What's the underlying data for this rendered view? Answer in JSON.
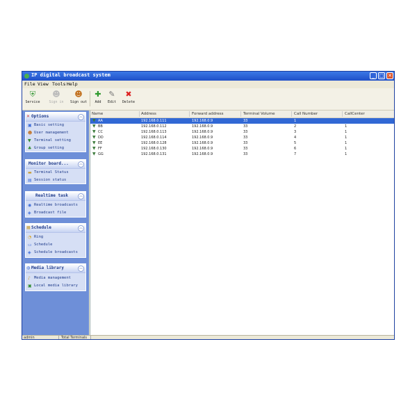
{
  "window": {
    "title": "IP digital broadcast system",
    "colors": {
      "titlebar": "#1f4fc8",
      "sidebar": "#6e8fd8",
      "selection": "#3168d5"
    }
  },
  "menu": [
    "File",
    "View",
    "Tools",
    "Help"
  ],
  "toolbar": {
    "items": [
      {
        "label": "Service",
        "icon": "shield-icon",
        "enabled": true
      },
      {
        "label": "Sign in",
        "icon": "user-icon",
        "enabled": false
      },
      {
        "label": "Sign out",
        "icon": "user-out-icon",
        "enabled": true
      },
      {
        "label": "Add",
        "icon": "add-icon",
        "enabled": true
      },
      {
        "label": "Edit",
        "icon": "edit-icon",
        "enabled": true
      },
      {
        "label": "Delete",
        "icon": "delete-icon",
        "enabled": true
      }
    ]
  },
  "sidebar": {
    "panels": [
      {
        "title": "Options",
        "icon": "options-icon",
        "items": [
          {
            "label": "Basic setting",
            "icon": "settings-icon"
          },
          {
            "label": "User management",
            "icon": "users-icon"
          },
          {
            "label": "Terminal setting",
            "icon": "terminal-icon"
          },
          {
            "label": "Group setting",
            "icon": "group-icon"
          }
        ]
      },
      {
        "title": "Monitor board...",
        "icon": "",
        "items": [
          {
            "label": "Terminal Status",
            "icon": "status-icon"
          },
          {
            "label": "Session status",
            "icon": "session-icon"
          }
        ]
      },
      {
        "title": "Realtime task",
        "icon": "",
        "items": [
          {
            "label": "Realtime broadcasts",
            "icon": "broadcast-icon"
          },
          {
            "label": "Broadcast file",
            "icon": "file-icon"
          }
        ]
      },
      {
        "title": "Schedule",
        "icon": "schedule-icon",
        "items": [
          {
            "label": "Ring",
            "icon": "ring-icon"
          },
          {
            "label": "Schedule",
            "icon": "calendar-icon"
          },
          {
            "label": "Schedule broadcasts",
            "icon": "schedule-broadcast-icon"
          }
        ]
      },
      {
        "title": "Media library",
        "icon": "media-icon",
        "items": [
          {
            "label": "Media management",
            "icon": "media-manage-icon"
          },
          {
            "label": "Local media library",
            "icon": "library-icon"
          }
        ]
      }
    ]
  },
  "table": {
    "columns": [
      "Name",
      "Address",
      "Forward address",
      "Terminal Volume",
      "Call Number",
      "CallCenter"
    ],
    "rows": [
      [
        "AA",
        "192.168.0.111",
        "192.168.0.9",
        "33",
        "1",
        ""
      ],
      [
        "BB",
        "192.168.0.112",
        "192.168.0.9",
        "33",
        "2",
        "1"
      ],
      [
        "CC",
        "192.168.0.113",
        "192.168.0.9",
        "33",
        "3",
        "1"
      ],
      [
        "DD",
        "192.168.0.114",
        "192.168.0.9",
        "33",
        "4",
        "1"
      ],
      [
        "EE",
        "192.168.0.128",
        "192.168.0.9",
        "33",
        "5",
        "1"
      ],
      [
        "FF",
        "192.168.0.130",
        "192.168.0.9",
        "33",
        "6",
        "1"
      ],
      [
        "GG",
        "192.168.0.131",
        "192.168.0.9",
        "33",
        "7",
        "1"
      ]
    ],
    "selected_row": 0
  },
  "status": {
    "user": "admin",
    "terminals": "Total Terminals"
  }
}
